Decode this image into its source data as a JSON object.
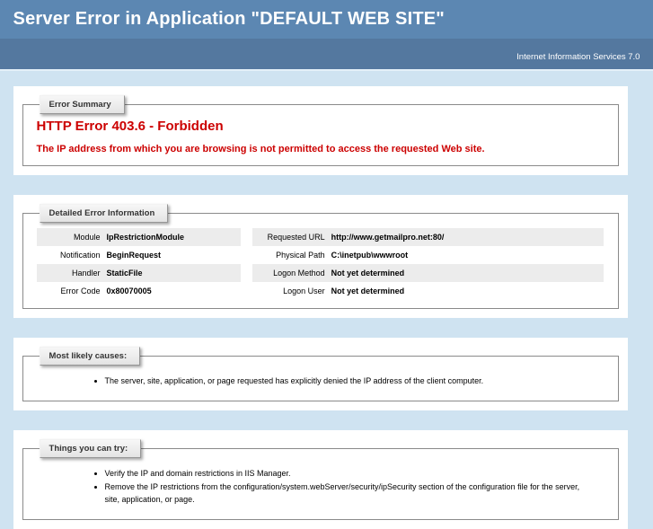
{
  "header": {
    "title": "Server Error in Application \"DEFAULT WEB SITE\""
  },
  "version_bar": {
    "text": "Internet Information Services 7.0"
  },
  "error_summary": {
    "legend": "Error Summary",
    "title": "HTTP Error 403.6 - Forbidden",
    "description": "The IP address from which you are browsing is not permitted to access the requested Web site."
  },
  "detailed_error": {
    "legend": "Detailed Error Information",
    "left": [
      {
        "label": "Module",
        "value": "IpRestrictionModule"
      },
      {
        "label": "Notification",
        "value": "BeginRequest"
      },
      {
        "label": "Handler",
        "value": "StaticFile"
      },
      {
        "label": "Error Code",
        "value": "0x80070005"
      }
    ],
    "right": [
      {
        "label": "Requested URL",
        "value": "http://www.getmailpro.net:80/"
      },
      {
        "label": "Physical Path",
        "value": "C:\\inetpub\\wwwroot"
      },
      {
        "label": "Logon Method",
        "value": "Not yet determined"
      },
      {
        "label": "Logon User",
        "value": "Not yet determined"
      }
    ]
  },
  "most_likely_causes": {
    "legend": "Most likely causes:",
    "items": [
      "The server, site, application, or page requested has explicitly denied the IP address of the client computer."
    ]
  },
  "things_you_can_try": {
    "legend": "Things you can try:",
    "items": [
      "Verify the IP and domain restrictions in IIS Manager.",
      "Remove the IP restrictions from the configuration/system.webServer/security/ipSecurity section of the configuration file for the server, site, application, or page."
    ]
  },
  "colors": {
    "header_bg": "#5C87B2",
    "version_bar_bg": "#54789F",
    "page_bg": "#CFE3F1",
    "error_red": "#CC0000",
    "row_shade": "#ECECEC"
  }
}
